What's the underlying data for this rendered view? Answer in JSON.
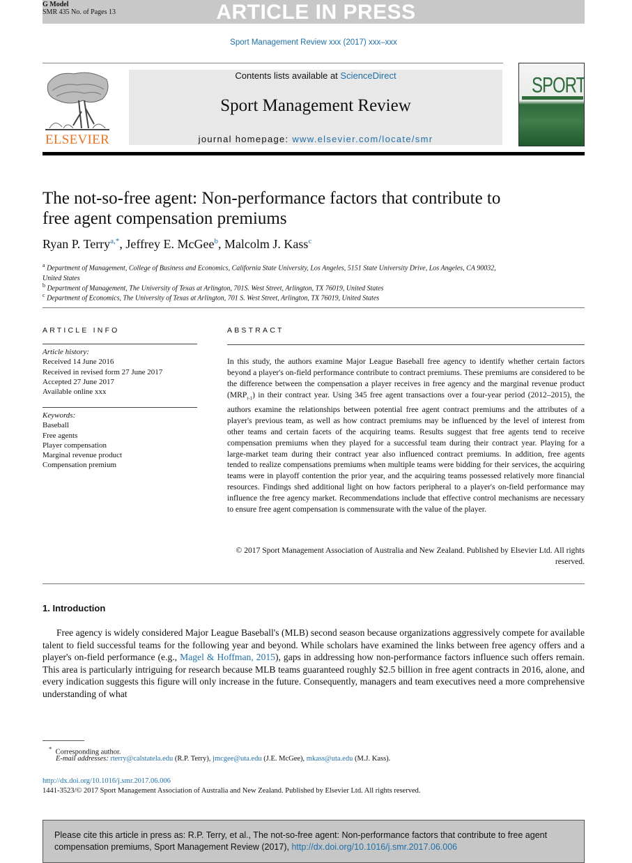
{
  "banner": {
    "g_model": "G Model",
    "manuscript": "SMR 435 No. of Pages 13",
    "status": "ARTICLE IN PRESS"
  },
  "journal_ref": "Sport Management Review xxx (2017) xxx–xxx",
  "masthead": {
    "publisher": "ELSEVIER",
    "contents_prefix": "Contents lists available at ",
    "contents_link": "ScienceDirect",
    "journal_title": "Sport Management Review",
    "homepage_prefix": "journal homepage: ",
    "homepage_link": "www.elsevier.com/locate/smr",
    "cover_word": "SPORT"
  },
  "article": {
    "title": "The not-so-free agent: Non-performance factors that contribute to free agent compensation premiums",
    "authors": [
      {
        "name": "Ryan P. Terry",
        "sup": "a,*"
      },
      {
        "name": "Jeffrey E. McGee",
        "sup": "b"
      },
      {
        "name": "Malcolm J. Kass",
        "sup": "c"
      }
    ],
    "affiliations": [
      {
        "sup": "a",
        "text": "Department of Management, College of Business and Economics, California State University, Los Angeles, 5151 State University Drive, Los Angeles, CA 90032, United States"
      },
      {
        "sup": "b",
        "text": "Department of Management, The University of Texas at Arlington, 701S. West Street, Arlington, TX 76019, United States"
      },
      {
        "sup": "c",
        "text": "Department of Economics, The University of Texas at Arlington, 701 S. West Street, Arlington, TX 76019, United States"
      }
    ]
  },
  "article_info": {
    "heading": "ARTICLE INFO",
    "history_label": "Article history:",
    "history": [
      "Received 14 June 2016",
      "Received in revised form 27 June 2017",
      "Accepted 27 June 2017",
      "Available online xxx"
    ],
    "keywords_label": "Keywords:",
    "keywords": [
      "Baseball",
      "Free agents",
      "Player compensation",
      "Marginal revenue product",
      "Compensation premium"
    ]
  },
  "abstract": {
    "heading": "ABSTRACT",
    "text_part1": "In this study, the authors examine Major League Baseball free agency to identify whether certain factors beyond a player's on-field performance contribute to contract premiums. These premiums are considered to be the difference between the compensation a player receives in free agency and the marginal revenue product (MRP",
    "subscript": "t-1",
    "text_part2": ") in their contract year. Using 345 free agent transactions over a four-year period (2012–2015), the authors examine the relationships between potential free agent contract premiums and the attributes of a player's previous team, as well as how contract premiums may be influenced by the level of interest from other teams and certain facets of the acquiring teams. Results suggest that free agents tend to receive compensation premiums when they played for a successful team during their contract year. Playing for a large-market team during their contract year also influenced contract premiums. In addition, free agents tended to realize compensations premiums when multiple teams were bidding for their services, the acquiring teams were in playoff contention the prior year, and the acquiring teams possessed relatively more financial resources. Findings shed additional light on how factors peripheral to a player's on-field performance may influence the free agency market. Recommendations include that effective control mechanisms are necessary to ensure free agent compensation is commensurate with the value of the player.",
    "copyright": "© 2017 Sport Management Association of Australia and New Zealand. Published by Elsevier Ltd. All rights reserved."
  },
  "introduction": {
    "heading": "1. Introduction",
    "text_part1": "Free agency is widely considered Major League Baseball's (MLB) second season because organizations aggressively compete for available talent to field successful teams for the following year and beyond. While scholars have examined the links between free agency offers and a player's on-field performance (e.g., ",
    "citation_link": "Magel & Hoffman, 2015",
    "text_part2": "), gaps in addressing how non-performance factors influence such offers remain. This area is particularly intriguing for research because MLB teams guaranteed roughly $2.5 billion in free agent contracts in 2016, alone, and every indication suggests this figure will only increase in the future. Consequently, managers and team executives need a more comprehensive understanding of what"
  },
  "footnotes": {
    "corresponding_mark": "*",
    "corresponding": "Corresponding author.",
    "email_label": "E-mail addresses:",
    "emails": [
      {
        "address": "rterry@calstatela.edu",
        "who": "(R.P.  Terry),"
      },
      {
        "address": "jmcgee@uta.edu",
        "who": "(J.E.  McGee),"
      },
      {
        "address": "mkass@uta.edu",
        "who": "(M.J.  Kass)."
      }
    ],
    "doi": "http://dx.doi.org/10.1016/j.smr.2017.06.006",
    "issn_copyright": "1441-3523/© 2017 Sport Management Association of Australia and New Zealand. Published by Elsevier Ltd. All rights reserved."
  },
  "cite_box": {
    "text": "Please cite this article in press as: R.P. Terry, et al., The not-so-free agent: Non-performance factors that contribute to free agent compensation premiums, Sport Management Review (2017), ",
    "link": "http://dx.doi.org/10.1016/j.smr.2017.06.006"
  },
  "colors": {
    "link": "#1f6fa8",
    "elsevier_orange": "#e8731e",
    "banner_gray": "#c8c8c8",
    "cover_green": "#2f6b3c"
  }
}
